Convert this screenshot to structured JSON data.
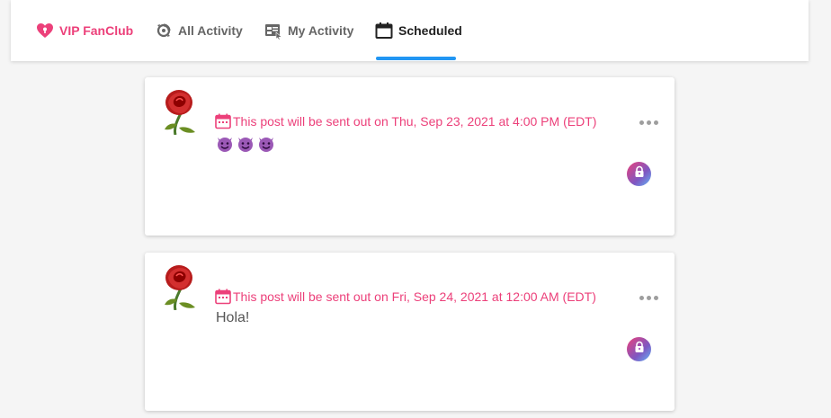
{
  "nav": {
    "tabs": [
      {
        "label": "VIP FanClub",
        "icon": "heart-lock-icon",
        "active": false
      },
      {
        "label": "All Activity",
        "icon": "refresh-globe-icon",
        "active": false
      },
      {
        "label": "My Activity",
        "icon": "dashboard-icon",
        "active": false
      },
      {
        "label": "Scheduled",
        "icon": "calendar-icon",
        "active": true
      }
    ],
    "accent_color": "#ec407a",
    "active_underline_color": "#2196f3"
  },
  "posts": [
    {
      "avatar_icon": "rose-icon",
      "schedule_text": "This post will be sent out on Thu, Sep 23, 2021 at 4:00 PM (EDT)",
      "body_emojis": [
        "😈",
        "😈",
        "😈"
      ],
      "body_text": "",
      "badge_icon": "lock-icon"
    },
    {
      "avatar_icon": "rose-icon",
      "schedule_text": "This post will be sent out on Fri, Sep 24, 2021 at 12:00 AM (EDT)",
      "body_emojis": [],
      "body_text": "Hola!",
      "badge_icon": "lock-icon"
    }
  ]
}
